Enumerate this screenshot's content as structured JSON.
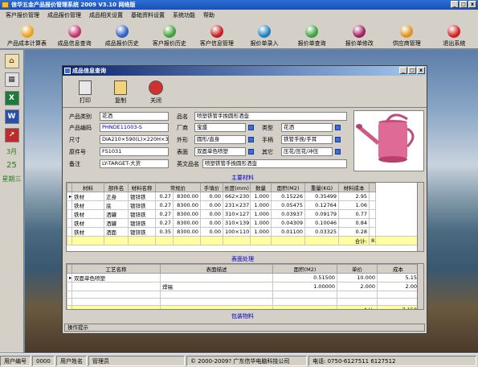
{
  "app": {
    "title": "信华五金产品报价管理系统 2009 V3.10 网络版"
  },
  "menu": [
    "客户报价管理",
    "成品报价管理",
    "成品相关设置",
    "基础资料设置",
    "系统功能",
    "帮助"
  ],
  "toolbar": [
    {
      "label": "产品成本计算表",
      "color": "#e8a020"
    },
    {
      "label": "成品信息查询",
      "color": "#c03070"
    },
    {
      "label": "成品报价历史",
      "color": "#3060c0"
    },
    {
      "label": "客户报价历史",
      "color": "#40a040"
    },
    {
      "label": "客户信息管理",
      "color": "#c02020"
    },
    {
      "label": "报价单录入",
      "color": "#2080c0"
    },
    {
      "label": "报价单查询",
      "color": "#40a040"
    },
    {
      "label": "报价单修改",
      "color": "#a02060"
    },
    {
      "label": "供应商管理",
      "color": "#e09020"
    },
    {
      "label": "退出系统",
      "color": "#d02020"
    }
  ],
  "sidebar": {
    "month": "3月",
    "day": "25",
    "weekday": "星期三"
  },
  "dialog": {
    "title": "成品信息查询",
    "buttons": [
      "打印",
      "复制",
      "关闭"
    ],
    "form": {
      "category_label": "产品类别",
      "category": "花洒",
      "code_label": "产品编码",
      "code": "PHNDE11003-S",
      "size_label": "尺寸",
      "size": "DIA210×590(L)×220H×350",
      "orig_label": "原件号",
      "orig": "FS1031",
      "remark_label": "备注",
      "remark": "LY-TARGET-大货",
      "name_label": "品名",
      "name": "喷塑铁管手挽圆形洒壶",
      "factory_label": "厂商",
      "factory": "宝盛",
      "shape_label": "外形",
      "shape": "圆形/直身",
      "surface_label": "表面",
      "surface": "双面单色喷塑",
      "type_label": "类型",
      "type": "花洒",
      "handle_label": "手柄",
      "handle": "铁管手挽/手耳",
      "other_label": "其它",
      "other": "压花/压花/冲压",
      "en_label": "英文品名",
      "en": "喷塑铁管手挽圆形洒壶"
    },
    "materials_title": "主要材料",
    "materials_headers": [
      "材料",
      "部件名",
      "材料名称",
      "常规价",
      "手填价",
      "长度(mm)",
      "数量",
      "面积(M2)",
      "重量(KG)",
      "材料成本"
    ],
    "materials_rows": [
      [
        "铁材",
        "正身",
        "镀锌铁",
        "0.27",
        "8300.00",
        "0.00",
        "662×230",
        "1.000",
        "0.15226",
        "0.35499",
        "2.95"
      ],
      [
        "铁材",
        "底",
        "镀锌铁",
        "0.27",
        "8300.00",
        "0.00",
        "231×237",
        "1.000",
        "0.05475",
        "0.12764",
        "1.06"
      ],
      [
        "铁材",
        "洒罐",
        "镀锌铁",
        "0.27",
        "8300.00",
        "0.00",
        "310×127",
        "1.000",
        "0.03937",
        "0.09179",
        "0.77"
      ],
      [
        "铁材",
        "洒罐",
        "镀锌铁",
        "0.27",
        "8300.00",
        "0.00",
        "310×139",
        "1.000",
        "0.04309",
        "0.10046",
        "0.84"
      ],
      [
        "铁材",
        "洒面",
        "镀锌铁",
        "0.35",
        "8300.00",
        "0.00",
        "100×110",
        "1.000",
        "0.01100",
        "0.03325",
        "0.28"
      ]
    ],
    "materials_total_label": "合计:",
    "materials_total": "8.750",
    "surface_title": "表面处理",
    "surface_headers": [
      "工艺名称",
      "表面描述",
      "面积(M2)",
      "单价",
      "成本"
    ],
    "surface_rows": [
      [
        "双面单色喷塑",
        "",
        "0.51500",
        "10.000",
        "5.15"
      ],
      [
        "",
        "焊锡",
        "1.00000",
        "2.000",
        "2.00"
      ]
    ],
    "surface_total_label": "合计:",
    "surface_total": "7.150",
    "packaging_title": "包装物料",
    "op_hint": "操作提示"
  },
  "status": {
    "user_no_label": "用户编号",
    "user_no": "0000",
    "user_name_label": "用户姓名",
    "user_name": "管理员",
    "copyright": "©  2000-2009?   广东信华电脑科技公司",
    "phone": "电话: 0750-6127511   6127512"
  }
}
